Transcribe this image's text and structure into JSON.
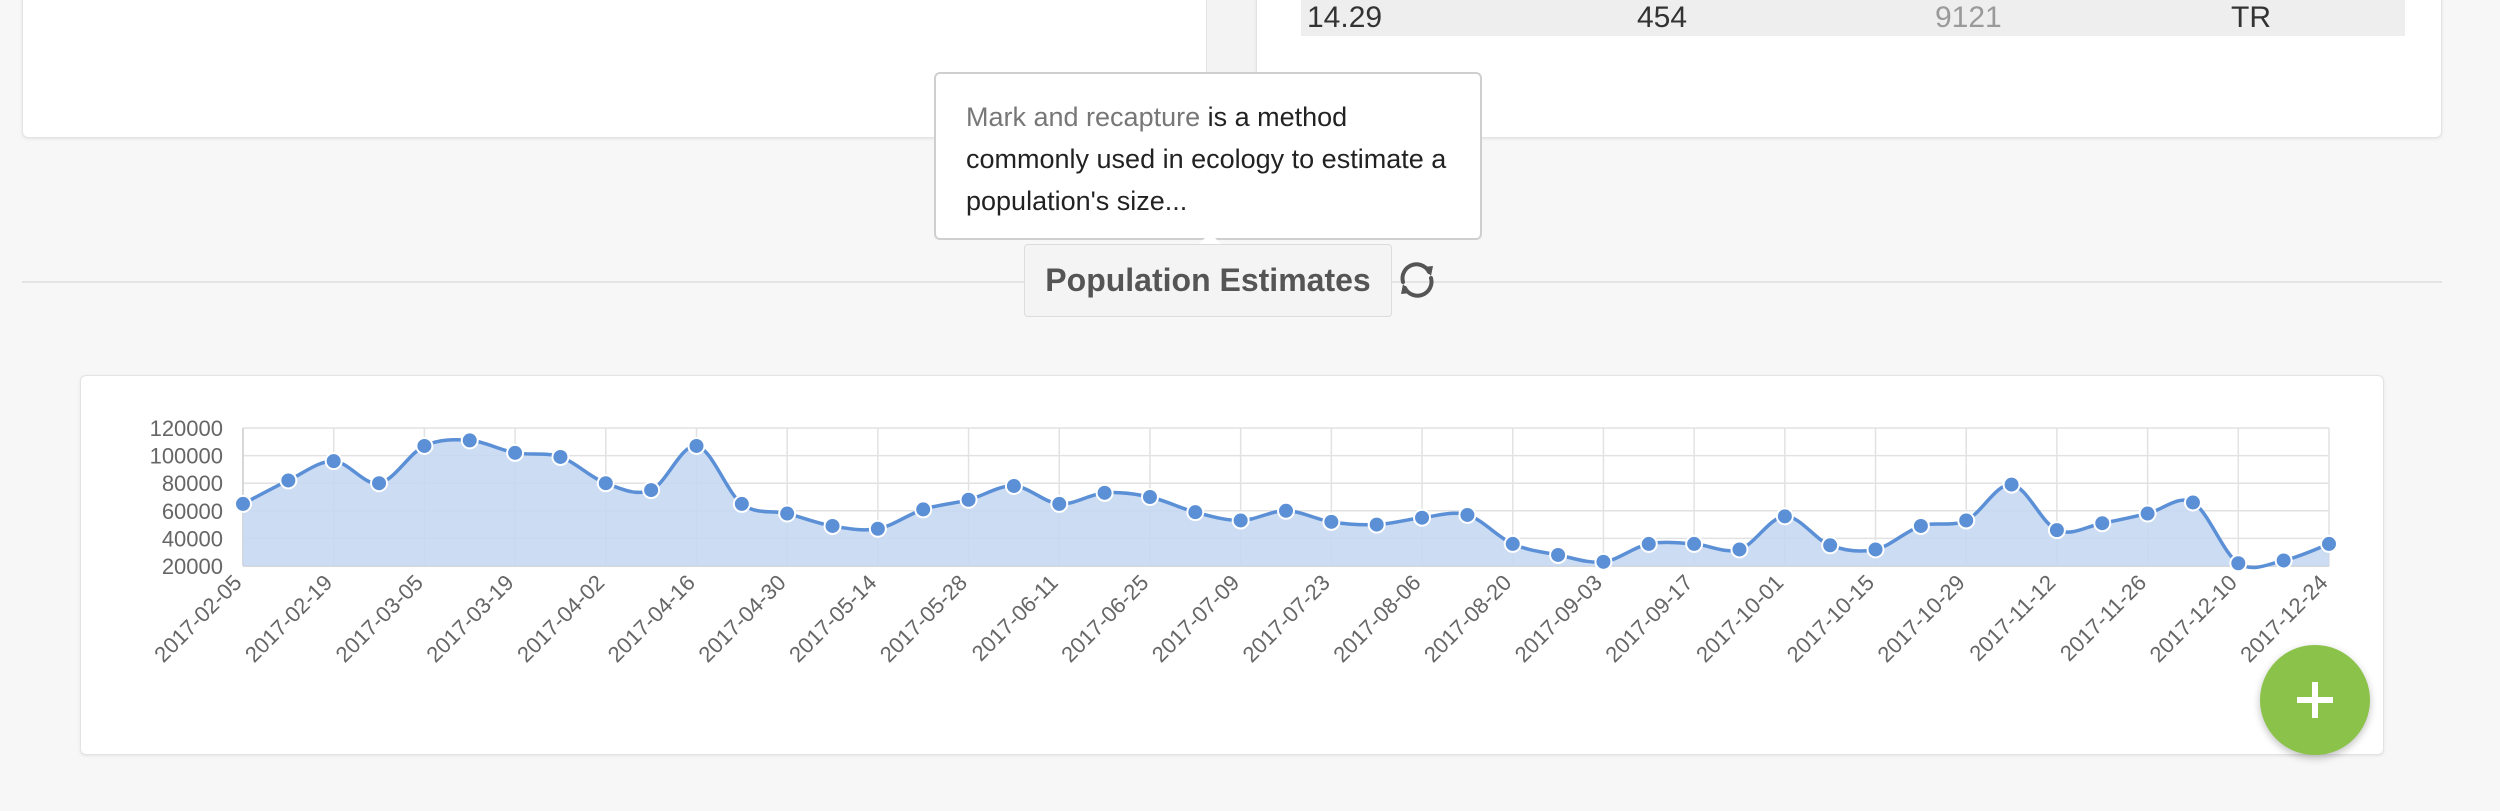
{
  "top_table": {
    "row": [
      "14.29",
      "454",
      "9121",
      "TR"
    ]
  },
  "tooltip": {
    "link_text": "Mark and recapture",
    "text": " is a method commonly used in ecology to estimate a population's size..."
  },
  "section": {
    "title": "Population Estimates",
    "refresh_icon": "refresh-icon"
  },
  "fab": {
    "icon": "plus-icon",
    "color": "#8bc34a"
  },
  "chart_data": {
    "type": "area",
    "title": "",
    "xlabel": "",
    "ylabel": "",
    "ylim": [
      20000,
      120000
    ],
    "yticks": [
      20000,
      40000,
      60000,
      80000,
      100000,
      120000
    ],
    "grid": true,
    "legend": "none",
    "color": "#5b8fd6",
    "fill": "#c5d8f2",
    "x_tick_labels": [
      "2017-02-05",
      "2017-02-19",
      "2017-03-05",
      "2017-03-19",
      "2017-04-02",
      "2017-04-16",
      "2017-04-30",
      "2017-05-14",
      "2017-05-28",
      "2017-06-11",
      "2017-06-25",
      "2017-07-09",
      "2017-07-23",
      "2017-08-06",
      "2017-08-20",
      "2017-09-03",
      "2017-09-17",
      "2017-10-01",
      "2017-10-15",
      "2017-10-29",
      "2017-11-12",
      "2017-11-26",
      "2017-12-10",
      "2017-12-24"
    ],
    "x": [
      "2017-02-05",
      "2017-02-12",
      "2017-02-19",
      "2017-02-26",
      "2017-03-05",
      "2017-03-12",
      "2017-03-19",
      "2017-03-26",
      "2017-04-02",
      "2017-04-09",
      "2017-04-16",
      "2017-04-23",
      "2017-04-30",
      "2017-05-07",
      "2017-05-14",
      "2017-05-21",
      "2017-05-28",
      "2017-06-04",
      "2017-06-11",
      "2017-06-18",
      "2017-06-25",
      "2017-07-02",
      "2017-07-09",
      "2017-07-16",
      "2017-07-23",
      "2017-07-30",
      "2017-08-06",
      "2017-08-13",
      "2017-08-20",
      "2017-08-27",
      "2017-09-03",
      "2017-09-10",
      "2017-09-17",
      "2017-09-24",
      "2017-10-01",
      "2017-10-08",
      "2017-10-15",
      "2017-10-22",
      "2017-10-29",
      "2017-11-05",
      "2017-11-12",
      "2017-11-19",
      "2017-11-26",
      "2017-12-03",
      "2017-12-10",
      "2017-12-17",
      "2017-12-24"
    ],
    "series": [
      {
        "values": [
          65000,
          82000,
          96000,
          80000,
          107000,
          111000,
          102000,
          99000,
          80000,
          75000,
          107000,
          65000,
          58000,
          49000,
          47000,
          61000,
          68000,
          78000,
          65000,
          73000,
          70000,
          59000,
          53000,
          60000,
          52000,
          50000,
          55000,
          57000,
          36000,
          28000,
          23000,
          36000,
          36000,
          32000,
          56000,
          35000,
          32000,
          49000,
          53000,
          79000,
          46000,
          51000,
          58000,
          66000,
          22000,
          24000,
          36000
        ]
      }
    ]
  }
}
